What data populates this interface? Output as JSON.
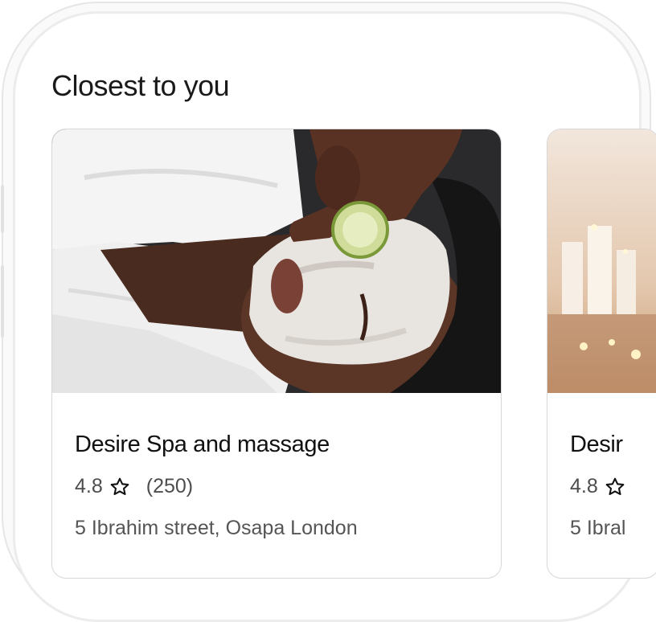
{
  "section": {
    "title": "Closest to you"
  },
  "cards": [
    {
      "image": "facial-mask-cucumber-photo",
      "name": "Desire Spa and massage",
      "rating": "4.8",
      "reviews": "(250)",
      "address": "5 Ibrahim street, Osapa London"
    },
    {
      "image": "candles-spa-photo",
      "name": "Desir",
      "rating": "4.8",
      "address": "5 Ibral"
    }
  ],
  "icons": {
    "rating": "star-outline-icon"
  },
  "colors": {
    "text": "#111111",
    "muted": "#555555",
    "border": "#d7d7d7"
  }
}
